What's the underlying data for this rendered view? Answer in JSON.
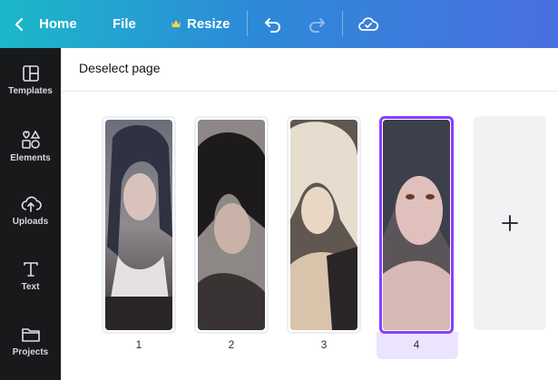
{
  "topbar": {
    "home_label": "Home",
    "file_label": "File",
    "resize_label": "Resize",
    "icons": [
      "chevron-left-icon",
      "crown-icon",
      "undo-icon",
      "redo-icon",
      "cloud-check-icon"
    ]
  },
  "sidebar": {
    "items": [
      {
        "label": "Templates",
        "icon": "templates-icon"
      },
      {
        "label": "Elements",
        "icon": "elements-icon"
      },
      {
        "label": "Uploads",
        "icon": "upload-icon"
      },
      {
        "label": "Text",
        "icon": "text-icon"
      },
      {
        "label": "Projects",
        "icon": "folder-icon"
      }
    ]
  },
  "main": {
    "deselect_label": "Deselect page",
    "pages": [
      {
        "number": "1",
        "selected": false
      },
      {
        "number": "2",
        "selected": false
      },
      {
        "number": "3",
        "selected": false
      },
      {
        "number": "4",
        "selected": true
      }
    ],
    "add_page_icon": "plus-icon"
  },
  "colors": {
    "selection": "#8b3dff",
    "sidebar_bg": "#18191b",
    "topbar_gradient_start": "#1bb8c9",
    "topbar_gradient_end": "#4a6fe0"
  }
}
